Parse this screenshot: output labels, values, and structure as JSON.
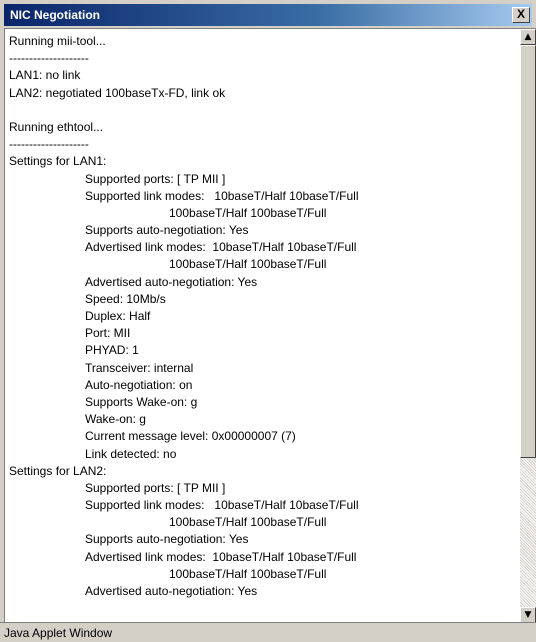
{
  "window": {
    "title": "NIC Negotiation",
    "close_glyph": "X"
  },
  "lines": [
    {
      "indent": 0,
      "text": "Running mii-tool..."
    },
    {
      "indent": 0,
      "text": "--------------------"
    },
    {
      "indent": 0,
      "text": "LAN1: no link"
    },
    {
      "indent": 0,
      "text": "LAN2: negotiated 100baseTx-FD, link ok"
    },
    {
      "indent": 0,
      "text": ""
    },
    {
      "indent": 0,
      "text": "Running ethtool..."
    },
    {
      "indent": 0,
      "text": "--------------------"
    },
    {
      "indent": 0,
      "text": "Settings for LAN1:"
    },
    {
      "indent": 1,
      "text": "Supported ports: [ TP MII ]"
    },
    {
      "indent": 1,
      "text": "Supported link modes:   10baseT/Half 10baseT/Full"
    },
    {
      "indent": 2,
      "text": "100baseT/Half 100baseT/Full"
    },
    {
      "indent": 1,
      "text": "Supports auto-negotiation: Yes"
    },
    {
      "indent": 1,
      "text": "Advertised link modes:  10baseT/Half 10baseT/Full"
    },
    {
      "indent": 2,
      "text": "100baseT/Half 100baseT/Full"
    },
    {
      "indent": 1,
      "text": "Advertised auto-negotiation: Yes"
    },
    {
      "indent": 1,
      "text": "Speed: 10Mb/s"
    },
    {
      "indent": 1,
      "text": "Duplex: Half"
    },
    {
      "indent": 1,
      "text": "Port: MII"
    },
    {
      "indent": 1,
      "text": "PHYAD: 1"
    },
    {
      "indent": 1,
      "text": "Transceiver: internal"
    },
    {
      "indent": 1,
      "text": "Auto-negotiation: on"
    },
    {
      "indent": 1,
      "text": "Supports Wake-on: g"
    },
    {
      "indent": 1,
      "text": "Wake-on: g"
    },
    {
      "indent": 1,
      "text": "Current message level: 0x00000007 (7)"
    },
    {
      "indent": 1,
      "text": "Link detected: no"
    },
    {
      "indent": 0,
      "text": "Settings for LAN2:"
    },
    {
      "indent": 1,
      "text": "Supported ports: [ TP MII ]"
    },
    {
      "indent": 1,
      "text": "Supported link modes:   10baseT/Half 10baseT/Full"
    },
    {
      "indent": 2,
      "text": "100baseT/Half 100baseT/Full"
    },
    {
      "indent": 1,
      "text": "Supports auto-negotiation: Yes"
    },
    {
      "indent": 1,
      "text": "Advertised link modes:  10baseT/Half 10baseT/Full"
    },
    {
      "indent": 2,
      "text": "100baseT/Half 100baseT/Full"
    },
    {
      "indent": 1,
      "text": "Advertised auto-negotiation: Yes"
    }
  ],
  "scrollbar": {
    "up_glyph": "▲",
    "down_glyph": "▼"
  },
  "status": {
    "text": "Java Applet Window"
  }
}
